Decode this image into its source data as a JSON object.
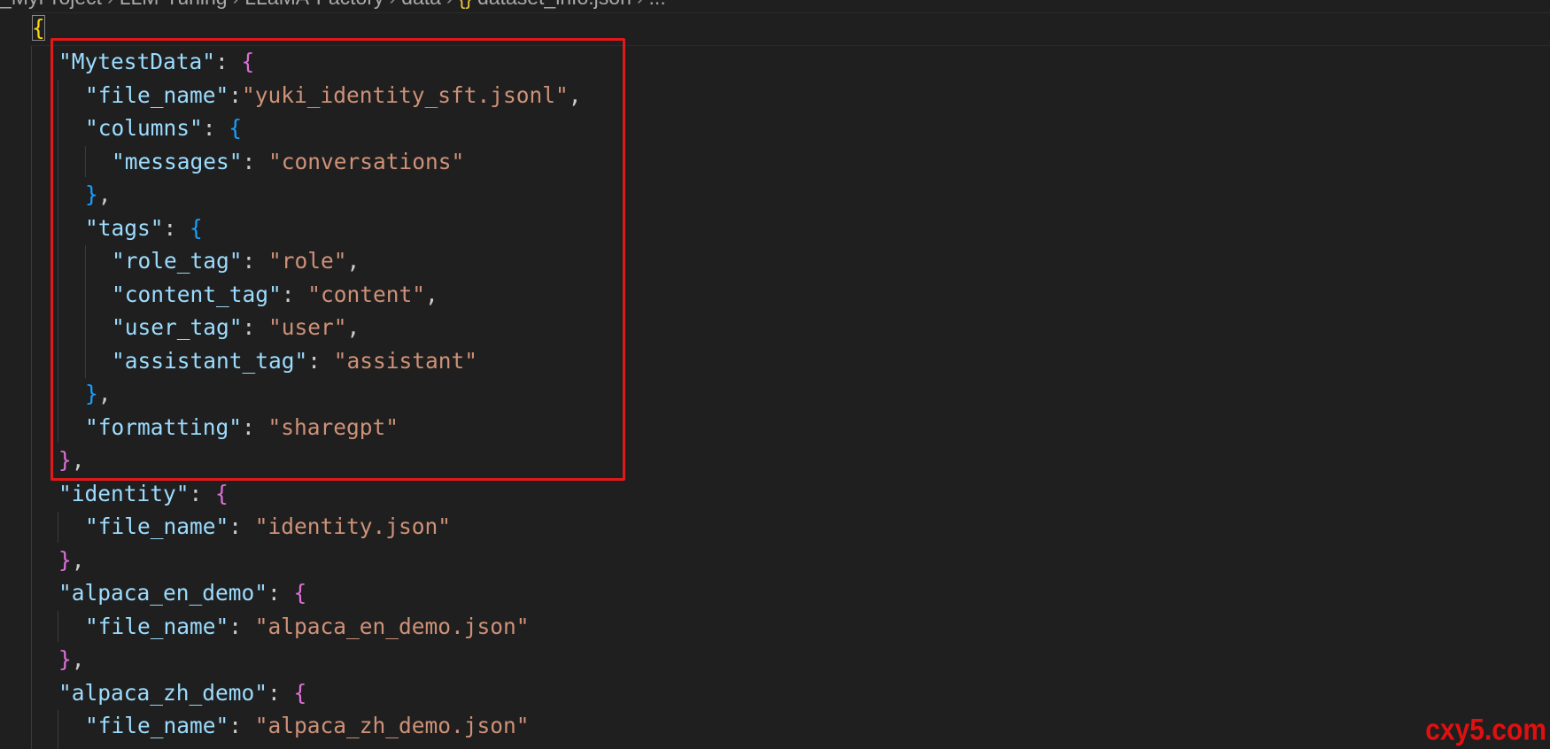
{
  "breadcrumb": {
    "items": [
      "_MyProject",
      "LLM-Tuning",
      "LLaMA-Factory",
      "data",
      "dataset_info.json",
      "..."
    ],
    "file_icon": "{}"
  },
  "code": {
    "root_open": "{",
    "entries": [
      {
        "key": "\"MytestData\"",
        "file_name_key": "\"file_name\"",
        "file_name_value": "\"yuki_identity_sft.jsonl\"",
        "columns_key": "\"columns\"",
        "messages_key": "\"messages\"",
        "messages_value": "\"conversations\"",
        "tags_key": "\"tags\"",
        "role_tag_key": "\"role_tag\"",
        "role_tag_value": "\"role\"",
        "content_tag_key": "\"content_tag\"",
        "content_tag_value": "\"content\"",
        "user_tag_key": "\"user_tag\"",
        "user_tag_value": "\"user\"",
        "assistant_tag_key": "\"assistant_tag\"",
        "assistant_tag_value": "\"assistant\"",
        "formatting_key": "\"formatting\"",
        "formatting_value": "\"sharegpt\""
      },
      {
        "key": "\"identity\"",
        "file_name_key": "\"file_name\"",
        "file_name_value": "\"identity.json\""
      },
      {
        "key": "\"alpaca_en_demo\"",
        "file_name_key": "\"file_name\"",
        "file_name_value": "\"alpaca_en_demo.json\""
      },
      {
        "key": "\"alpaca_zh_demo\"",
        "file_name_key": "\"file_name\"",
        "file_name_value": "\"alpaca_zh_demo.json\""
      }
    ]
  },
  "watermark": "cxy5.com",
  "colors": {
    "background": "#1f1f1f",
    "key": "#9cdcfe",
    "string": "#ce9178",
    "bracket_level1": "#ffd700",
    "bracket_level2": "#da70d6",
    "bracket_level3": "#179fff",
    "highlight_box": "#e01a1a",
    "watermark": "#e01010"
  }
}
